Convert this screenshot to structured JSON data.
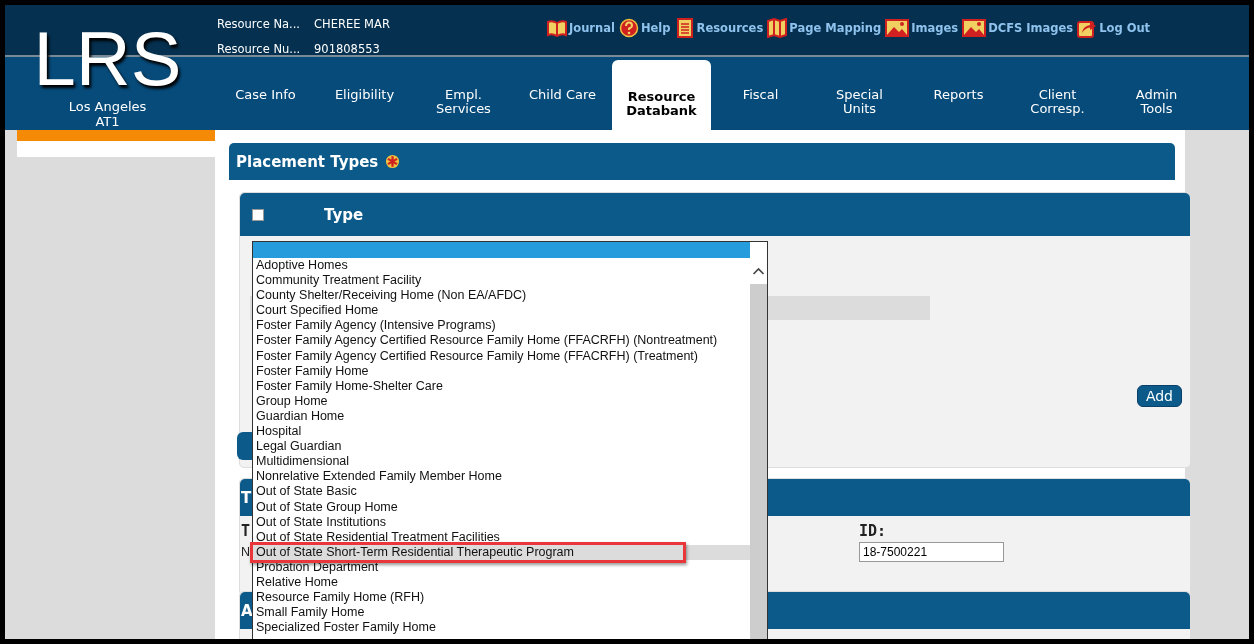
{
  "header": {
    "logo": "LRS",
    "office": "Los Angeles",
    "office_code": "AT1",
    "info": [
      {
        "label": "Resource Na...",
        "value": "CHEREE MAR"
      },
      {
        "label": "Resource Nu...",
        "value": "901808553"
      }
    ],
    "links": [
      {
        "label": "Journal",
        "kind": "book"
      },
      {
        "label": "Help",
        "kind": "help"
      },
      {
        "label": "Resources",
        "kind": "document"
      },
      {
        "label": "Page Mapping",
        "kind": "map"
      },
      {
        "label": "Images",
        "kind": "image"
      },
      {
        "label": "DCFS Images",
        "kind": "image"
      },
      {
        "label": "Log Out",
        "kind": "logout"
      }
    ]
  },
  "tabs": [
    {
      "label": "Case Info",
      "selected": false
    },
    {
      "label": "Eligibility",
      "selected": false
    },
    {
      "label": "Empl. Services",
      "selected": false
    },
    {
      "label": "Child Care",
      "selected": false
    },
    {
      "label": "Resource Databank",
      "selected": true
    },
    {
      "label": "Fiscal",
      "selected": false
    },
    {
      "label": "Special Units",
      "selected": false
    },
    {
      "label": "Reports",
      "selected": false
    },
    {
      "label": "Client Corresp.",
      "selected": false
    },
    {
      "label": "Admin Tools",
      "selected": false
    }
  ],
  "placement_panel": {
    "title": "Placement Types",
    "required": true,
    "table_header": {
      "checked": false,
      "label": "Type"
    },
    "add_button": "Add"
  },
  "second_panel": {
    "header": "T",
    "label_1": "T",
    "label_2": "N",
    "id_label": "ID:",
    "id_value": "18-7500221"
  },
  "third_panel": {
    "header": "A"
  },
  "dropdown": {
    "empty_option_selected": true,
    "options": [
      {
        "label": "Adoptive Homes",
        "selected": false,
        "hovered": false
      },
      {
        "label": "Community Treatment Facility",
        "selected": false,
        "hovered": false
      },
      {
        "label": "County Shelter/Receiving Home (Non EA/AFDC)",
        "selected": false,
        "hovered": false
      },
      {
        "label": "Court Specified Home",
        "selected": false,
        "hovered": false
      },
      {
        "label": "Foster Family Agency (Intensive Programs)",
        "selected": false,
        "hovered": false
      },
      {
        "label": "Foster Family Agency Certified Resource Family Home (FFACRFH) (Nontreatment)",
        "selected": false,
        "hovered": false
      },
      {
        "label": "Foster Family Agency Certified Resource Family Home (FFACRFH) (Treatment)",
        "selected": false,
        "hovered": false
      },
      {
        "label": "Foster Family Home",
        "selected": false,
        "hovered": false
      },
      {
        "label": "Foster Family Home-Shelter Care",
        "selected": false,
        "hovered": false
      },
      {
        "label": "Group Home",
        "selected": false,
        "hovered": false
      },
      {
        "label": "Guardian Home",
        "selected": false,
        "hovered": false
      },
      {
        "label": "Hospital",
        "selected": false,
        "hovered": false
      },
      {
        "label": "Legal Guardian",
        "selected": false,
        "hovered": false
      },
      {
        "label": "Multidimensional",
        "selected": false,
        "hovered": false
      },
      {
        "label": "Nonrelative Extended Family Member Home",
        "selected": false,
        "hovered": false
      },
      {
        "label": "Out of State Basic",
        "selected": false,
        "hovered": false
      },
      {
        "label": "Out of State Group Home",
        "selected": false,
        "hovered": false
      },
      {
        "label": "Out of State Institutions",
        "selected": false,
        "hovered": false
      },
      {
        "label": "Out of State Residential Treatment Facilities",
        "selected": false,
        "hovered": false
      },
      {
        "label": "Out of State Short-Term Residential Therapeutic Program",
        "selected": false,
        "hovered": true,
        "callout": true
      },
      {
        "label": "Probation Department",
        "selected": false,
        "hovered": false
      },
      {
        "label": "Relative Home",
        "selected": false,
        "hovered": false
      },
      {
        "label": "Resource Family Home (RFH)",
        "selected": false,
        "hovered": false
      },
      {
        "label": "Small Family Home",
        "selected": false,
        "hovered": false
      },
      {
        "label": "Specialized Foster Family Home",
        "selected": false,
        "hovered": false
      }
    ]
  }
}
